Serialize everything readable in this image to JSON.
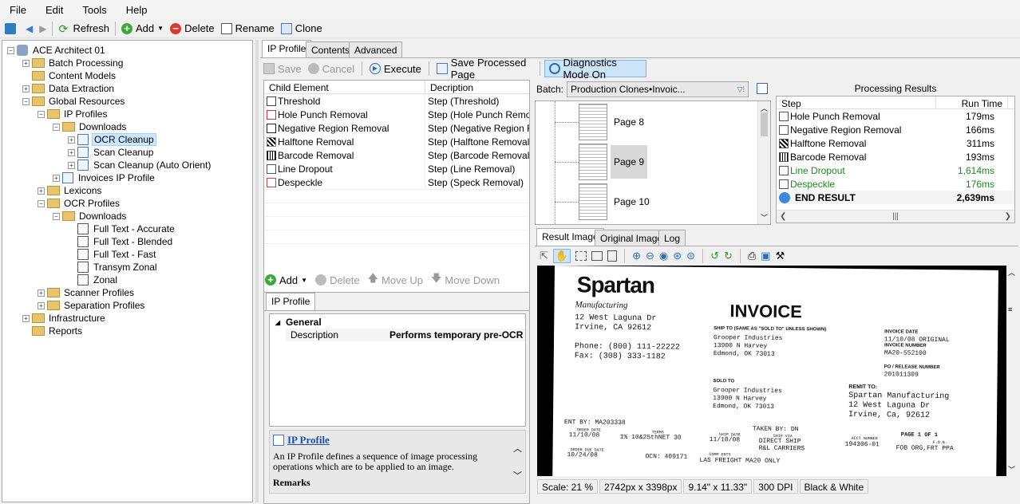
{
  "menu": [
    "File",
    "Edit",
    "Tools",
    "Help"
  ],
  "toolbar": {
    "refresh": "Refresh",
    "add": "Add",
    "delete": "Delete",
    "rename": "Rename",
    "clone": "Clone"
  },
  "tree": [
    {
      "label": "ACE Architect 01",
      "level": 0,
      "exp": "-",
      "icon": "database-icon"
    },
    {
      "label": "Batch Processing",
      "level": 1,
      "exp": "+",
      "icon": "folder-icon"
    },
    {
      "label": "Content Models",
      "level": 1,
      "exp": "",
      "icon": "folder-icon"
    },
    {
      "label": "Data Extraction",
      "level": 1,
      "exp": "+",
      "icon": "folder-icon"
    },
    {
      "label": "Global Resources",
      "level": 1,
      "exp": "-",
      "icon": "folder-icon"
    },
    {
      "label": "IP Profiles",
      "level": 2,
      "exp": "-",
      "icon": "folder-icon"
    },
    {
      "label": "Downloads",
      "level": 3,
      "exp": "-",
      "icon": "folder-icon"
    },
    {
      "label": "OCR Cleanup",
      "level": 4,
      "exp": "+",
      "icon": "ip-profile-icon",
      "selected": true
    },
    {
      "label": "Scan Cleanup",
      "level": 4,
      "exp": "+",
      "icon": "ip-profile-icon"
    },
    {
      "label": "Scan Cleanup (Auto Orient)",
      "level": 4,
      "exp": "+",
      "icon": "ip-profile-icon"
    },
    {
      "label": "Invoices IP Profile",
      "level": 3,
      "exp": "+",
      "icon": "ip-profile-icon"
    },
    {
      "label": "Lexicons",
      "level": 2,
      "exp": "+",
      "icon": "folder-icon"
    },
    {
      "label": "OCR Profiles",
      "level": 2,
      "exp": "-",
      "icon": "folder-icon"
    },
    {
      "label": "Downloads",
      "level": 3,
      "exp": "-",
      "icon": "folder-icon"
    },
    {
      "label": "Full Text - Accurate",
      "level": 4,
      "exp": "",
      "icon": "ocr-profile-icon"
    },
    {
      "label": "Full Text - Blended",
      "level": 4,
      "exp": "",
      "icon": "ocr-profile-icon"
    },
    {
      "label": "Full Text - Fast",
      "level": 4,
      "exp": "",
      "icon": "ocr-profile-icon"
    },
    {
      "label": "Transym Zonal",
      "level": 4,
      "exp": "",
      "icon": "ocr-profile-icon"
    },
    {
      "label": "Zonal",
      "level": 4,
      "exp": "",
      "icon": "ocr-profile-icon"
    },
    {
      "label": "Scanner Profiles",
      "level": 2,
      "exp": "+",
      "icon": "folder-icon"
    },
    {
      "label": "Separation Profiles",
      "level": 2,
      "exp": "+",
      "icon": "folder-icon"
    },
    {
      "label": "Infrastructure",
      "level": 1,
      "exp": "+",
      "icon": "folder-icon"
    },
    {
      "label": "Reports",
      "level": 1,
      "exp": "",
      "icon": "folder-icon"
    }
  ],
  "tabs": {
    "ip_profile": "IP Profile",
    "contents": "Contents",
    "advanced": "Advanced"
  },
  "actions": {
    "save": "Save",
    "cancel": "Cancel",
    "execute": "Execute",
    "save_processed": "Save Processed Page",
    "diagnostics": "Diagnostics Mode On"
  },
  "steps_grid": {
    "headers": [
      "Child Element",
      "Decription"
    ],
    "rows": [
      {
        "name": "Threshold",
        "desc": "Step (Threshold)"
      },
      {
        "name": "Hole Punch Removal",
        "desc": "Step (Hole Punch Removal"
      },
      {
        "name": "Negative Region Removal",
        "desc": "Step (Negative Region Re"
      },
      {
        "name": "Halftone Removal",
        "desc": "Step (Halftone Removal)"
      },
      {
        "name": "Barcode Removal",
        "desc": "Step (Barcode Removal)"
      },
      {
        "name": "Line Dropout",
        "desc": "Step (Line Removal)"
      },
      {
        "name": "Despeckle",
        "desc": "Step (Speck Removal)"
      }
    ]
  },
  "grid_actions": {
    "add": "Add",
    "delete": "Delete",
    "move_up": "Move Up",
    "move_down": "Move Down"
  },
  "props": {
    "tab": "IP Profile",
    "section": "General",
    "key": "Description",
    "value": "Performs temporary pre-OCR"
  },
  "help": {
    "title": "IP Profile",
    "body": "An IP Profile defines a sequence of image processing operations which are to be applied to an image.",
    "remarks": "Remarks"
  },
  "batch": {
    "label": "Batch:",
    "value": "Production Clones•Invoic...",
    "pages": [
      "Page 8",
      "Page 9",
      "Page 10"
    ]
  },
  "results": {
    "title": "Processing Results",
    "headers": [
      "Step",
      "Run Time"
    ],
    "rows": [
      {
        "step": "Hole Punch Removal",
        "time": "179ms",
        "green": false
      },
      {
        "step": "Negative Region Removal",
        "time": "166ms",
        "green": false
      },
      {
        "step": "Halftone Removal",
        "time": "311ms",
        "green": false
      },
      {
        "step": "Barcode Removal",
        "time": "193ms",
        "green": false
      },
      {
        "step": "Line Dropout",
        "time": "1,614ms",
        "green": true
      },
      {
        "step": "Despeckle",
        "time": "176ms",
        "green": true
      }
    ],
    "total_label": "END RESULT",
    "total_time": "2,639ms"
  },
  "image_tabs": {
    "result": "Result Image",
    "original": "Original Image",
    "log": "Log"
  },
  "invoice": {
    "brand": "Spartan",
    "brand_sub": "Manufacturing",
    "title": "INVOICE",
    "addr1": "12 West Laguna Dr",
    "addr2": "Irvine, CA 92612",
    "phone": "Phone: (800) 111-22222",
    "fax": "Fax:  (308) 333-1182",
    "shipto_label": "SHIP TO (SAME AS \"SOLD TO\" UNLESS SHOWN)",
    "shipto": [
      "Grooper Industries",
      "13900 N Harvey",
      "Edmond, OK 73013"
    ],
    "inv_date_label": "INVOICE DATE",
    "inv_date": "11/10/08 ORIGINAL",
    "inv_num_label": "INVOICE NUMBER",
    "inv_num": "MA20-552100",
    "po_label": "PO / RELEASE NUMBER",
    "po": "201011309",
    "soldto_label": "SOLD TO",
    "soldto": [
      "Grooper Industries",
      "13900 N Harvey",
      "Edmond, OK 73013"
    ],
    "remit_label": "REMIT TO:",
    "remit": [
      "Spartan Manufacturing",
      "12 West Laguna Dr",
      "Irvine, Ca, 92612"
    ],
    "line1": "ENT BY: MA203338",
    "taken": "TAKEN BY: DN",
    "order_date_l": "ORDER DATE",
    "order_date": "11/10/08",
    "terms_l": "TERMS",
    "terms": "1% 10&25thNET 30",
    "ship_date_l": "SHIP DATE",
    "ship_date": "11/10/08",
    "ship_via_l": "SHIP VIA",
    "ship_via": "DIRECT SHIP\nR&L CARRIERS",
    "acct_l": "ACCT NUMBER",
    "acct": "194306-01",
    "page": "PAGE 1 OF 1",
    "fob_l": "F.O.B.",
    "fob": "FOB ORG,FRT PPA",
    "odd_l": "ORDER DUE DATE",
    "odd": "10/24/08",
    "ocn": "OCN: 409171",
    "comm_l": "COMM ENTS",
    "comm": "LAS FREIGHT  MA20 ONLY"
  },
  "status": [
    "Scale: 21 %",
    "2742px x 3398px",
    "9.14\" x 11.33\"",
    "300 DPI",
    "Black & White"
  ]
}
